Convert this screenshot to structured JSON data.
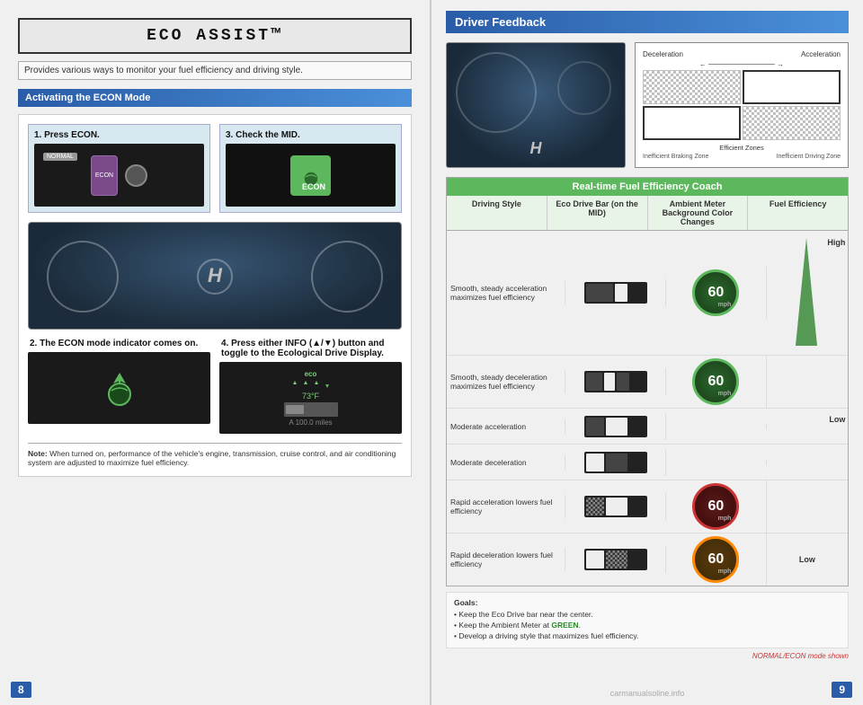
{
  "left": {
    "title": "ECO ASSIST™",
    "subtitle": "Provides various ways to monitor your fuel efficiency and driving style.",
    "section_header": "Activating the ECON Mode",
    "step1_label": "1.  Press ECON.",
    "step2_label": "2.  The ECON mode indicator comes on.",
    "step3_label": "3.  Check the MID.",
    "step4_label": "4.  Press either INFO (▲/▼) button and toggle to the Ecological Drive Display.",
    "note_prefix": "Note:",
    "note_text": " When turned on, performance of the vehicle's engine, transmission, cruise control, and air conditioning system are adjusted to maximize fuel efficiency.",
    "page_number": "8",
    "eco_display_text": "eco",
    "eco_temp": "73°F",
    "eco_miles": "A  100.0 miles"
  },
  "right": {
    "driver_feedback_title": "Driver Feedback",
    "zones": {
      "deceleration": "Deceleration",
      "acceleration": "Acceleration",
      "efficient_zones": "Efficient Zones",
      "inefficient_braking": "Inefficient Braking Zone",
      "inefficient_driving": "Inefficient Driving Zone"
    },
    "table": {
      "header": "Real-time Fuel Efficiency Coach",
      "col1": "Driving Style",
      "col2": "Eco Drive Bar (on the MID)",
      "col3": "Ambient Meter Background Color Changes",
      "col4": "Fuel Efficiency",
      "rows": [
        {
          "style": "Smooth, steady acceleration maximizes fuel efficiency",
          "bar_type": "right_white",
          "circle_color": "green",
          "circle_number": "60"
        },
        {
          "style": "Smooth, steady deceleration maximizes fuel efficiency",
          "bar_type": "center_white",
          "circle_color": "green",
          "circle_number": "60"
        },
        {
          "style": "Moderate acceleration",
          "bar_type": "far_right",
          "circle_color": null,
          "circle_number": null
        },
        {
          "style": "Moderate deceleration",
          "bar_type": "far_left",
          "circle_color": null,
          "circle_number": null
        },
        {
          "style": "Rapid acceleration lowers fuel efficiency",
          "bar_type": "check_right",
          "circle_color": "red",
          "circle_number": "60"
        },
        {
          "style": "Rapid deceleration lowers fuel efficiency",
          "bar_type": "check_left",
          "circle_color": "orange",
          "circle_number": "60"
        }
      ],
      "high_label": "High",
      "low_label": "Low"
    },
    "goals": {
      "title": "Goals:",
      "items": [
        "• Keep the Eco Drive bar near the center.",
        "• Keep the Ambient Meter at GREEN.",
        "• Develop a driving style that maximizes fuel efficiency."
      ]
    },
    "mode_note": "NORMAL/ECON mode shown",
    "page_number": "9"
  }
}
